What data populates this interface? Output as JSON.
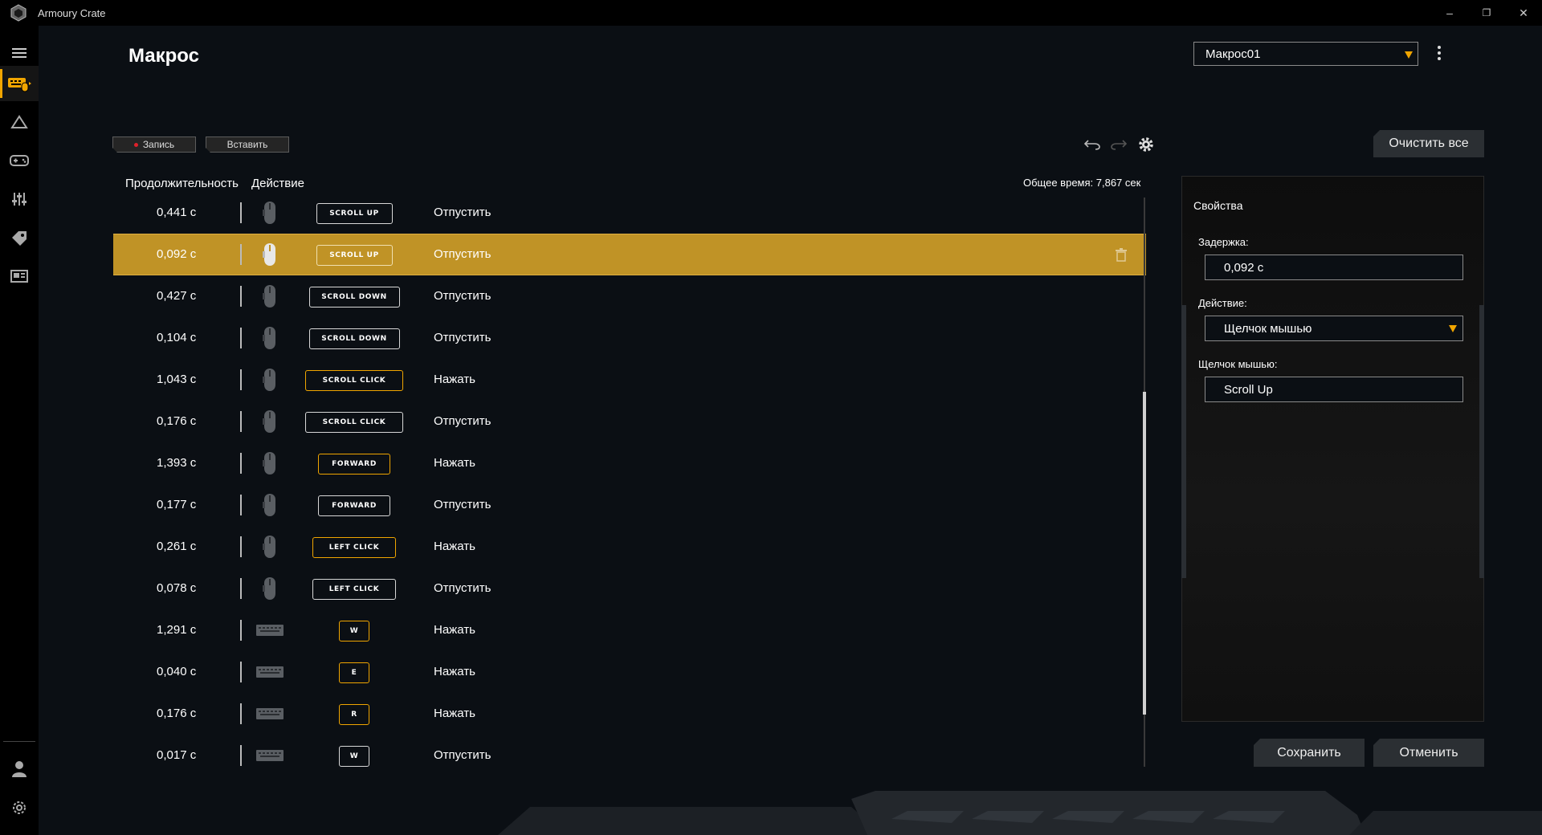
{
  "app": {
    "title": "Armoury Crate"
  },
  "window_controls": {
    "minimize": "–",
    "restore": "❐",
    "close": "✕"
  },
  "page": {
    "title": "Макрос"
  },
  "profile": {
    "selected": "Макрос01"
  },
  "toolbar": {
    "record_label": "Запись",
    "insert_label": "Вставить",
    "clear_all_label": "Очистить все"
  },
  "list": {
    "col_duration": "Продолжительность",
    "col_action": "Действие",
    "total_time": "Общее время: 7,867 сек",
    "rows": [
      {
        "duration": "0,441 с",
        "device": "mouse",
        "key": "SCROLL UP",
        "action": "Отпустить"
      },
      {
        "duration": "0,092 с",
        "device": "mouse",
        "key": "SCROLL UP",
        "action": "Отпустить",
        "selected": true
      },
      {
        "duration": "0,427 с",
        "device": "mouse",
        "key": "SCROLL DOWN",
        "action": "Отпустить"
      },
      {
        "duration": "0,104 с",
        "device": "mouse",
        "key": "SCROLL DOWN",
        "action": "Отпустить"
      },
      {
        "duration": "1,043 с",
        "device": "mouse",
        "key": "SCROLL CLICK",
        "action": "Нажать"
      },
      {
        "duration": "0,176 с",
        "device": "mouse",
        "key": "SCROLL CLICK",
        "action": "Отпустить"
      },
      {
        "duration": "1,393 с",
        "device": "mouse",
        "key": "FORWARD",
        "action": "Нажать"
      },
      {
        "duration": "0,177 с",
        "device": "mouse",
        "key": "FORWARD",
        "action": "Отпустить"
      },
      {
        "duration": "0,261 с",
        "device": "mouse",
        "key": "LEFT CLICK",
        "action": "Нажать"
      },
      {
        "duration": "0,078 с",
        "device": "mouse",
        "key": "LEFT CLICK",
        "action": "Отпустить"
      },
      {
        "duration": "1,291 с",
        "device": "keyboard",
        "key": "W",
        "action": "Нажать"
      },
      {
        "duration": "0,040 с",
        "device": "keyboard",
        "key": "E",
        "action": "Нажать"
      },
      {
        "duration": "0,176 с",
        "device": "keyboard",
        "key": "R",
        "action": "Нажать"
      },
      {
        "duration": "0,017 с",
        "device": "keyboard",
        "key": "W",
        "action": "Отпустить"
      }
    ]
  },
  "properties": {
    "title": "Свойства",
    "delay_label": "Задержка:",
    "delay_value": "0,092 с",
    "action_label": "Действие:",
    "action_value": "Щелчок мышью",
    "mouse_click_label": "Щелчок мышью:",
    "mouse_click_value": "Scroll Up"
  },
  "footer": {
    "save_label": "Сохранить",
    "cancel_label": "Отменить"
  },
  "colors": {
    "accent": "#f0a500",
    "selected_row": "#c09326",
    "background": "#0b0f14"
  }
}
